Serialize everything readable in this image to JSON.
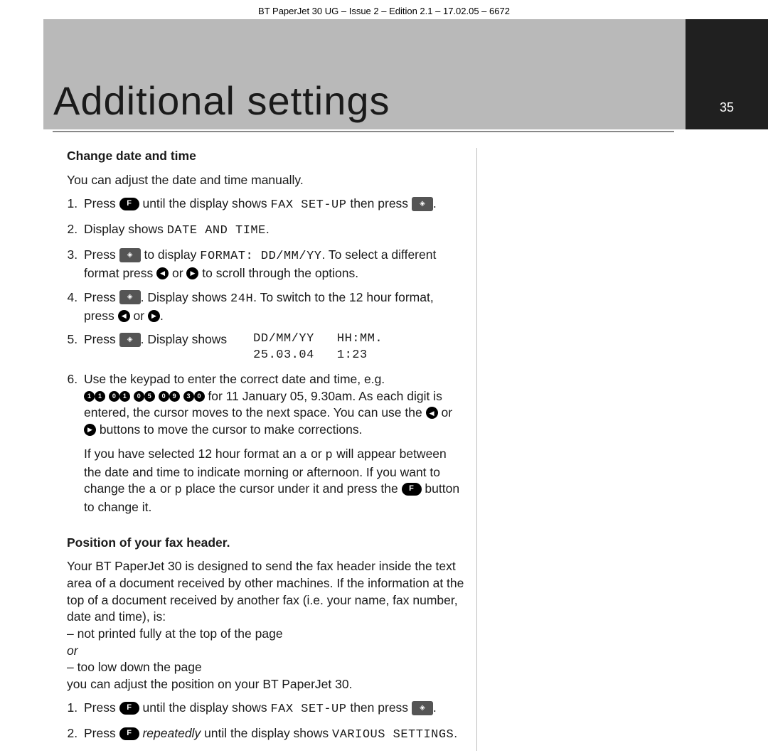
{
  "meta": "BT PaperJet 30 UG – Issue 2 – Edition 2.1 – 17.02.05 – 6672",
  "title": "Additional settings",
  "page_number": "35",
  "s1": {
    "heading": "Change date and time",
    "intro": "You can adjust the date and time manually.",
    "step1_a": "Press ",
    "step1_b": " until the display shows ",
    "step1_lcd1": "FAX SET-UP",
    "step1_c": " then press ",
    "step1_d": ".",
    "step2_a": "Display shows ",
    "step2_lcd": "DATE AND TIME",
    "step2_b": ".",
    "step3_a": "Press ",
    "step3_b": " to display ",
    "step3_lcd": "FORMAT: DD/MM/YY",
    "step3_c": ". To select a different format press ",
    "step3_d": " or ",
    "step3_e": " to scroll through the options.",
    "step4_a": "Press ",
    "step4_b": ". Display shows ",
    "step4_lcd": "24H",
    "step4_c": ". To switch to the 12 hour format, press ",
    "step4_d": " or ",
    "step4_e": ".",
    "step5_a": "Press ",
    "step5_b": ". Display shows",
    "step5_disp": "   DD/MM/YY   HH:MM.\n   25.03.04   1:23",
    "step6_a": "Use the keypad to enter the correct date and time, e.g. ",
    "step6_b": " for 11 January 05, 9.30am. As each digit is entered, the cursor moves to the next space. You can use the ",
    "step6_c": " or ",
    "step6_d": " buttons to move the cursor to make corrections.",
    "step6_extra_a": "If you have selected 12 hour format an ",
    "step6_lcd_a": "a",
    "step6_extra_b": " or ",
    "step6_lcd_p": "p",
    "step6_extra_c": " will appear between the date and time to indicate morning or afternoon. If you want to change the ",
    "step6_extra_d": " or ",
    "step6_extra_e": " place the cursor under it and press the ",
    "step6_extra_f": " button to change it.",
    "keys": [
      "1",
      "1",
      "0",
      "1",
      "0",
      "5",
      "0",
      "9",
      "3",
      "0"
    ]
  },
  "s2": {
    "heading": "Position of your fax header.",
    "p1": "Your BT PaperJet 30 is designed to send the fax header inside the text area of a document received by other machines. If the information at the top of a document received by another fax (i.e. your name, fax number, date and time), is:",
    "p2": "– not printed fully at the top of the page",
    "p3": "or",
    "p4": "– too low down the page",
    "p5": "you can adjust the position on your BT PaperJet 30.",
    "step1_a": "Press ",
    "step1_b": " until the display shows ",
    "step1_lcd": "FAX SET-UP",
    "step1_c": " then press ",
    "step1_d": ".",
    "step2_a": "Press ",
    "step2_b": " repeatedly",
    "step2_c": " until the display shows ",
    "step2_lcd": "VARIOUS SETTINGS",
    "step2_d": "."
  },
  "icons": {
    "f_label": "F"
  }
}
